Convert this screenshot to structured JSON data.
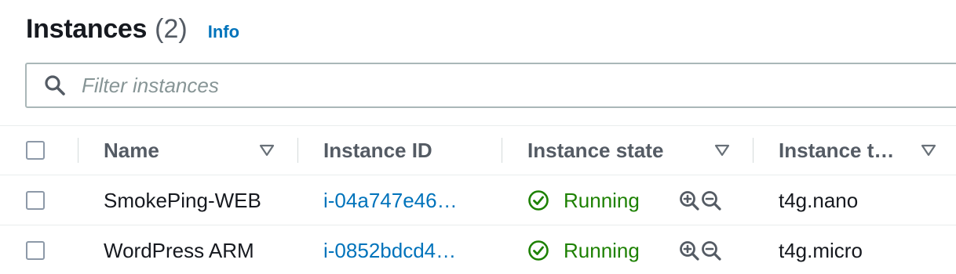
{
  "header": {
    "title": "Instances",
    "count": "(2)",
    "info_label": "Info"
  },
  "search": {
    "placeholder": "Filter instances",
    "value": ""
  },
  "table": {
    "columns": [
      {
        "label": "Name",
        "sortable": true
      },
      {
        "label": "Instance ID",
        "sortable": false
      },
      {
        "label": "Instance state",
        "sortable": true
      },
      {
        "label": "Instance t…",
        "sortable": true
      }
    ],
    "rows": [
      {
        "name": "SmokePing-WEB",
        "instance_id": "i-04a747e46…",
        "state": "Running",
        "type": "t4g.nano",
        "selected": false
      },
      {
        "name": "WordPress ARM",
        "instance_id": "i-0852bdcd4…",
        "state": "Running",
        "type": "t4g.micro",
        "selected": false
      }
    ]
  },
  "colors": {
    "link": "#0073bb",
    "running": "#1d8102",
    "header_text": "#545b64",
    "border": "#aab7b8"
  },
  "icons": {
    "search": "search-icon",
    "sort": "caret-down-icon",
    "state_running": "check-circle-icon",
    "zoom_in": "zoom-in-icon",
    "zoom_out": "zoom-out-icon"
  }
}
